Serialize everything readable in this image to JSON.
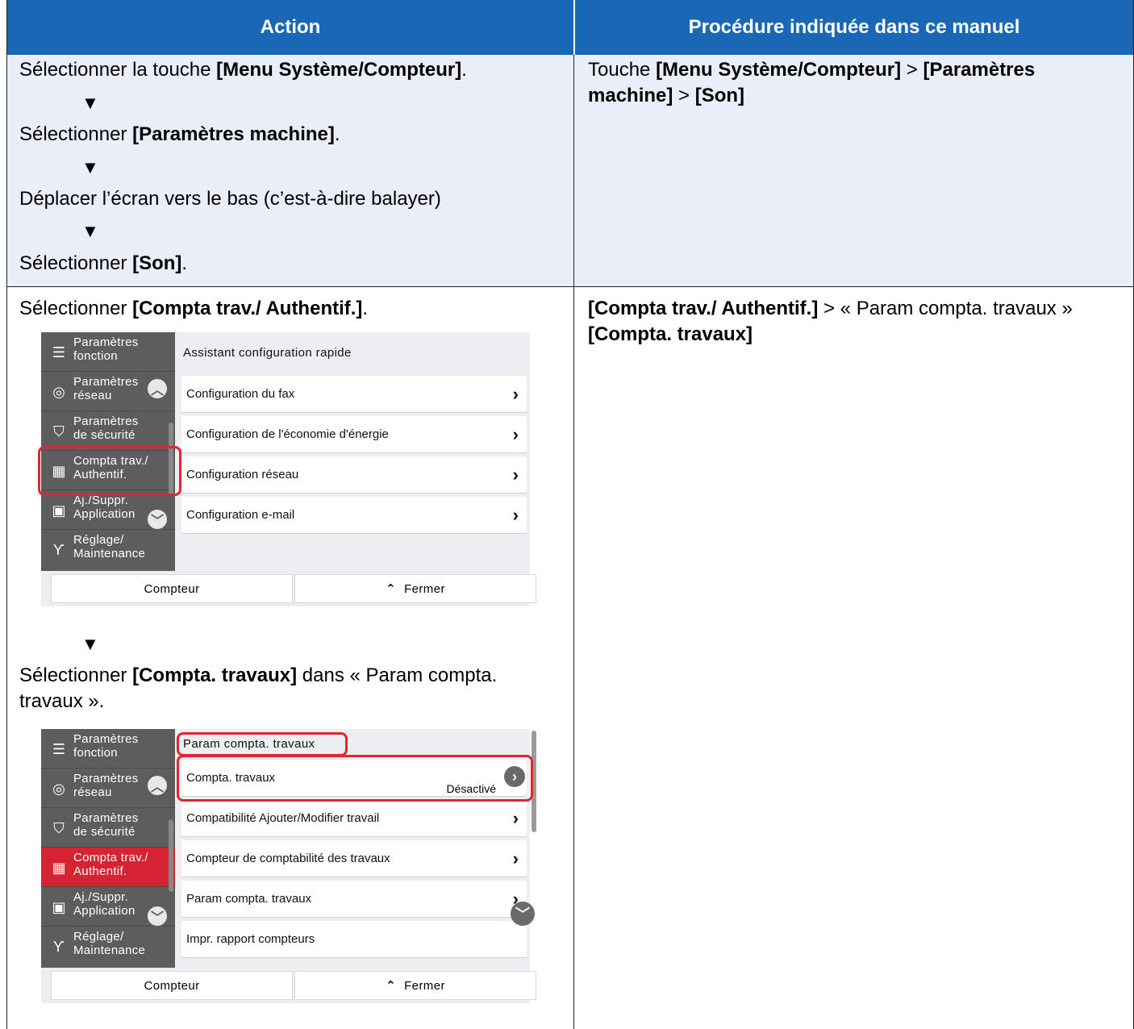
{
  "header": {
    "action": "Action",
    "procedure": "Procédure indiquée dans ce manuel"
  },
  "row1": {
    "step1_pre": "Sélectionner la touche ",
    "step1_bold": "[Menu Système/Compteur]",
    "step1_post": ".",
    "step2_pre": "Sélectionner ",
    "step2_bold": "[Paramètres machine]",
    "step2_post": ".",
    "step3": "Déplacer l’écran vers le bas (c’est-à-dire balayer)",
    "step4_pre": "Sélectionner ",
    "step4_bold": "[Son]",
    "step4_post": ".",
    "arrow": "▼",
    "right_pre": "Touche ",
    "right_bold1": "[Menu Système/Compteur]",
    "right_sep1": "  > ",
    "right_bold2": "[Paramètres",
    "right_bold3": "machine]",
    "right_sep2": " > ",
    "right_bold4": "[Son]"
  },
  "row2": {
    "step1_pre": "Sélectionner ",
    "step1_bold": "[Compta trav./ Authentif.]",
    "step1_post": ".",
    "step2_pre": "Sélectionner ",
    "step2_bold": "[Compta. travaux]",
    "step2_post": " dans « Param compta.",
    "step2_line2": "travaux ».",
    "arrow": "▼",
    "right_bold1": "[Compta trav./ Authentif.]",
    "right_text": " > « Param compta. travaux »",
    "right_bold2": "[Compta. travaux]"
  },
  "panel1": {
    "sidebar": [
      {
        "label": "Paramètres\nfonction",
        "icon": "list-icon"
      },
      {
        "label": "Paramètres\nréseau",
        "icon": "globe-icon"
      },
      {
        "label": "Paramètres\nde sécurité",
        "icon": "shield-icon"
      },
      {
        "label": "Compta trav./\nAuthentif.",
        "icon": "accounting-icon"
      },
      {
        "label": "Aj./Suppr.\nApplication",
        "icon": "app-icon"
      },
      {
        "label": "Réglage/\nMaintenance",
        "icon": "tools-icon"
      }
    ],
    "section_title": "Assistant configuration rapide",
    "items": [
      "Configuration du fax",
      "Configuration de l'économie d'énergie",
      "Configuration réseau",
      "Configuration e-mail"
    ],
    "footer_left": "Compteur",
    "footer_right": "Fermer"
  },
  "panel2": {
    "sidebar": [
      {
        "label": "Paramètres\nfonction",
        "icon": "list-icon"
      },
      {
        "label": "Paramètres\nréseau",
        "icon": "globe-icon"
      },
      {
        "label": "Paramètres\nde sécurité",
        "icon": "shield-icon"
      },
      {
        "label": "Compta trav./\nAuthentif.",
        "icon": "accounting-icon"
      },
      {
        "label": "Aj./Suppr.\nApplication",
        "icon": "app-icon"
      },
      {
        "label": "Réglage/\nMaintenance",
        "icon": "tools-icon"
      }
    ],
    "section_title": "Param compta. travaux",
    "items": [
      "Compta. travaux",
      "Compatibilité Ajouter/Modifier travail",
      "Compteur de comptabilité des travaux",
      "Param compta. travaux",
      "Impr. rapport compteurs"
    ],
    "item1_status": "Désactivé",
    "footer_left": "Compteur",
    "footer_right": "Fermer"
  }
}
